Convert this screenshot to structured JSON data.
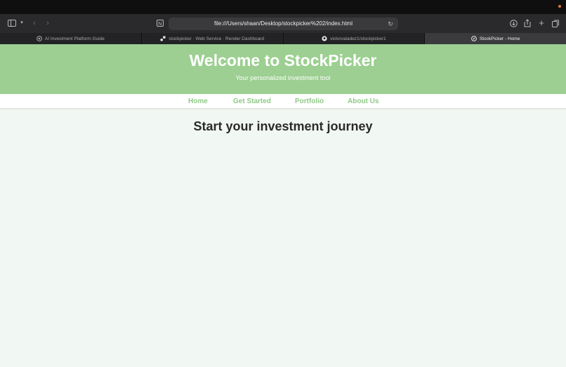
{
  "browser": {
    "address": "file:///Users/shaan/Desktop/stockpicker%202/index.html",
    "tabs": [
      {
        "label": "AI Investment Platform Guide",
        "icon": "openai-icon",
        "active": false
      },
      {
        "label": "stockpicker · Web Service · Render Dashboard",
        "icon": "render-icon",
        "active": false
      },
      {
        "label": "victorvaladez1/stockpicker1",
        "icon": "github-icon",
        "active": false
      },
      {
        "label": "StockPicker - Home",
        "icon": "compass-icon",
        "active": true
      }
    ]
  },
  "page": {
    "title": "Welcome to StockPicker",
    "subtitle": "Your personalized investment tool",
    "nav": [
      {
        "label": "Home"
      },
      {
        "label": "Get Started"
      },
      {
        "label": "Portfolio"
      },
      {
        "label": "About Us"
      }
    ],
    "heading": "Start your investment journey"
  },
  "colors": {
    "hero_bg": "#9ccf91",
    "nav_text": "#8fc987",
    "page_bg": "#f1f7f3"
  }
}
